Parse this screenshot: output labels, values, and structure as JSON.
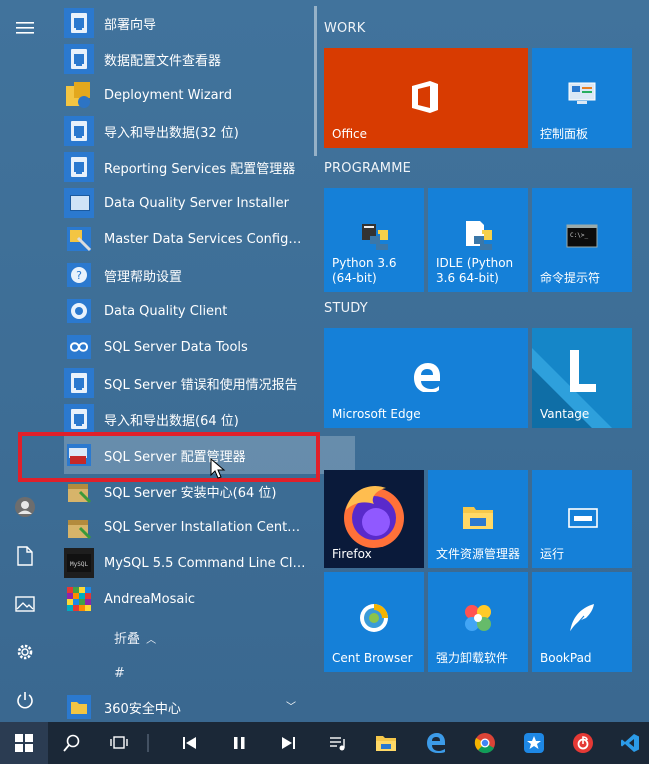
{
  "rail": {
    "icons": [
      "hamburger-menu-icon",
      "user-avatar-icon",
      "documents-icon",
      "pictures-icon",
      "settings-gear-icon",
      "power-icon"
    ]
  },
  "apps": [
    {
      "label": "部署向导",
      "icon": "doc"
    },
    {
      "label": "数据配置文件查看器",
      "icon": "doc"
    },
    {
      "label": "Deployment Wizard",
      "icon": "yellow"
    },
    {
      "label": "导入和导出数据(32 位)",
      "icon": "doc"
    },
    {
      "label": "Reporting Services 配置管理器",
      "icon": "doc"
    },
    {
      "label": "Data Quality Server Installer",
      "icon": "blue"
    },
    {
      "label": "Master Data Services Configurati...",
      "icon": "blue"
    },
    {
      "label": "管理帮助设置",
      "icon": "blue"
    },
    {
      "label": "Data Quality Client",
      "icon": "blue"
    },
    {
      "label": "SQL Server Data Tools",
      "icon": "blue"
    },
    {
      "label": "SQL Server 错误和使用情况报告",
      "icon": "doc"
    },
    {
      "label": "导入和导出数据(64 位)",
      "icon": "doc"
    },
    {
      "label": "SQL Server 配置管理器",
      "icon": "blue"
    },
    {
      "label": "SQL Server 安装中心(64 位)",
      "icon": "blue"
    },
    {
      "label": "SQL Server Installation Center (6...",
      "icon": "blue"
    },
    {
      "label": "MySQL 5.5 Command Line Client",
      "icon": "dark"
    },
    {
      "label": "AndreaMosaic",
      "icon": "blue"
    }
  ],
  "collapse_label": "折叠",
  "hash_header": "#",
  "last_app": {
    "label": "360安全中心"
  },
  "sections": {
    "work": "WORK",
    "programme": "PROGRAMME",
    "study": "STUDY"
  },
  "tiles": {
    "office": {
      "label": "Office",
      "color": "#d83b01"
    },
    "control_panel": {
      "label": "控制面板"
    },
    "python36": {
      "label": "Python 3.6 (64-bit)"
    },
    "idle": {
      "label": "IDLE (Python 3.6 64-bit)"
    },
    "cmd": {
      "label": "命令提示符"
    },
    "edge": {
      "label": "Microsoft Edge"
    },
    "vantage": {
      "label": "Vantage"
    },
    "firefox": {
      "label": "Firefox"
    },
    "explorer": {
      "label": "文件资源管理器"
    },
    "run": {
      "label": "运行"
    },
    "cent": {
      "label": "Cent Browser"
    },
    "uninstall": {
      "label": "强力卸载软件"
    },
    "bookpad": {
      "label": "BookPad"
    }
  },
  "taskbar": {
    "icons": [
      "windows-start-icon",
      "search-icon",
      "task-view-icon",
      "previous-track-icon",
      "pause-icon",
      "next-track-icon",
      "playlist-icon",
      "file-explorer-icon",
      "edge-icon",
      "chrome-icon",
      "star-app-icon",
      "netease-music-icon",
      "vscode-icon"
    ]
  },
  "colors": {
    "accent": "#1580d8",
    "highlight": "#e0202a",
    "taskbar": "#1b2837"
  }
}
